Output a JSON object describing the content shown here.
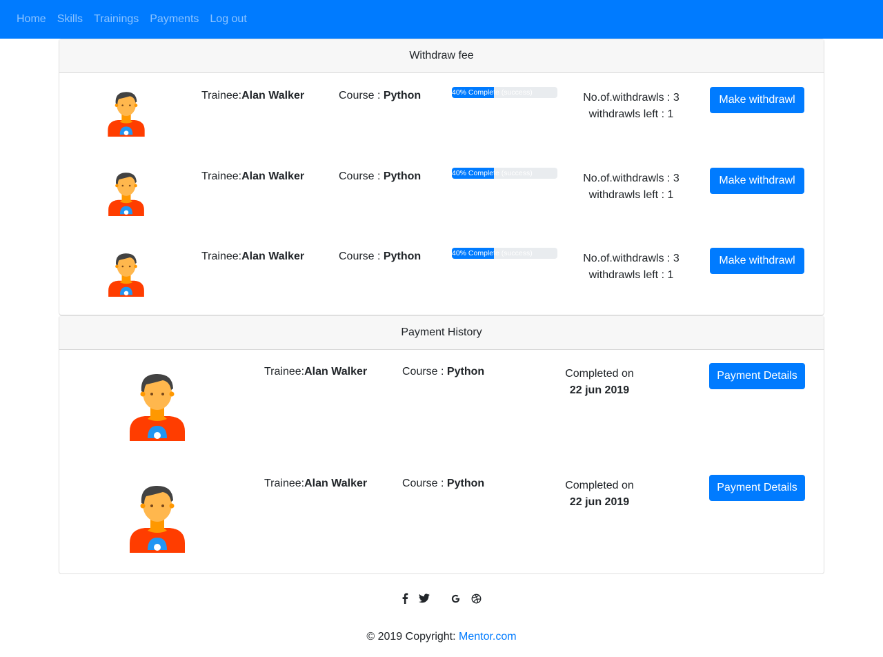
{
  "nav": {
    "items": [
      {
        "label": "Home"
      },
      {
        "label": "Skills"
      },
      {
        "label": "Trainings"
      },
      {
        "label": "Payments"
      },
      {
        "label": "Log out"
      }
    ]
  },
  "withdraw": {
    "header": "Withdraw fee",
    "rows": [
      {
        "trainee_label": "Trainee:",
        "trainee_name": "Alan Walker",
        "course_label": "Course : ",
        "course_name": "Python",
        "progress_value": 40,
        "progress_text": "40% Complete (success)",
        "withdrawals": "No.of.withdrawls : 3",
        "left": "withdrawls left : 1",
        "button": "Make withdrawl"
      },
      {
        "trainee_label": "Trainee:",
        "trainee_name": "Alan Walker",
        "course_label": "Course : ",
        "course_name": "Python",
        "progress_value": 40,
        "progress_text": "40% Complete (success)",
        "withdrawals": "No.of.withdrawls : 3",
        "left": "withdrawls left : 1",
        "button": "Make withdrawl"
      },
      {
        "trainee_label": "Trainee:",
        "trainee_name": "Alan Walker",
        "course_label": "Course : ",
        "course_name": "Python",
        "progress_value": 40,
        "progress_text": "40% Complete (success)",
        "withdrawals": "No.of.withdrawls : 3",
        "left": "withdrawls left : 1",
        "button": "Make withdrawl"
      }
    ]
  },
  "history": {
    "header": "Payment History",
    "rows": [
      {
        "trainee_label": "Trainee:",
        "trainee_name": "Alan Walker",
        "course_label": "Course : ",
        "course_name": "Python",
        "completed_label": "Completed on",
        "completed_date": "22 jun 2019",
        "button": "Payment Details"
      },
      {
        "trainee_label": "Trainee:",
        "trainee_name": "Alan Walker",
        "course_label": "Course : ",
        "course_name": "Python",
        "completed_label": "Completed on",
        "completed_date": "22 jun 2019",
        "button": "Payment Details"
      }
    ]
  },
  "footer": {
    "icons": [
      "facebook-icon",
      "twitter-icon",
      "google-icon",
      "dribbble-icon"
    ],
    "copyright_text": "© 2019 Copyright: ",
    "copyright_link": "Mentor.com"
  },
  "colors": {
    "primary": "#007bff",
    "avatar_shirt": "#ff3d00",
    "avatar_skin": "#ffb74d",
    "avatar_hair": "#424242"
  }
}
